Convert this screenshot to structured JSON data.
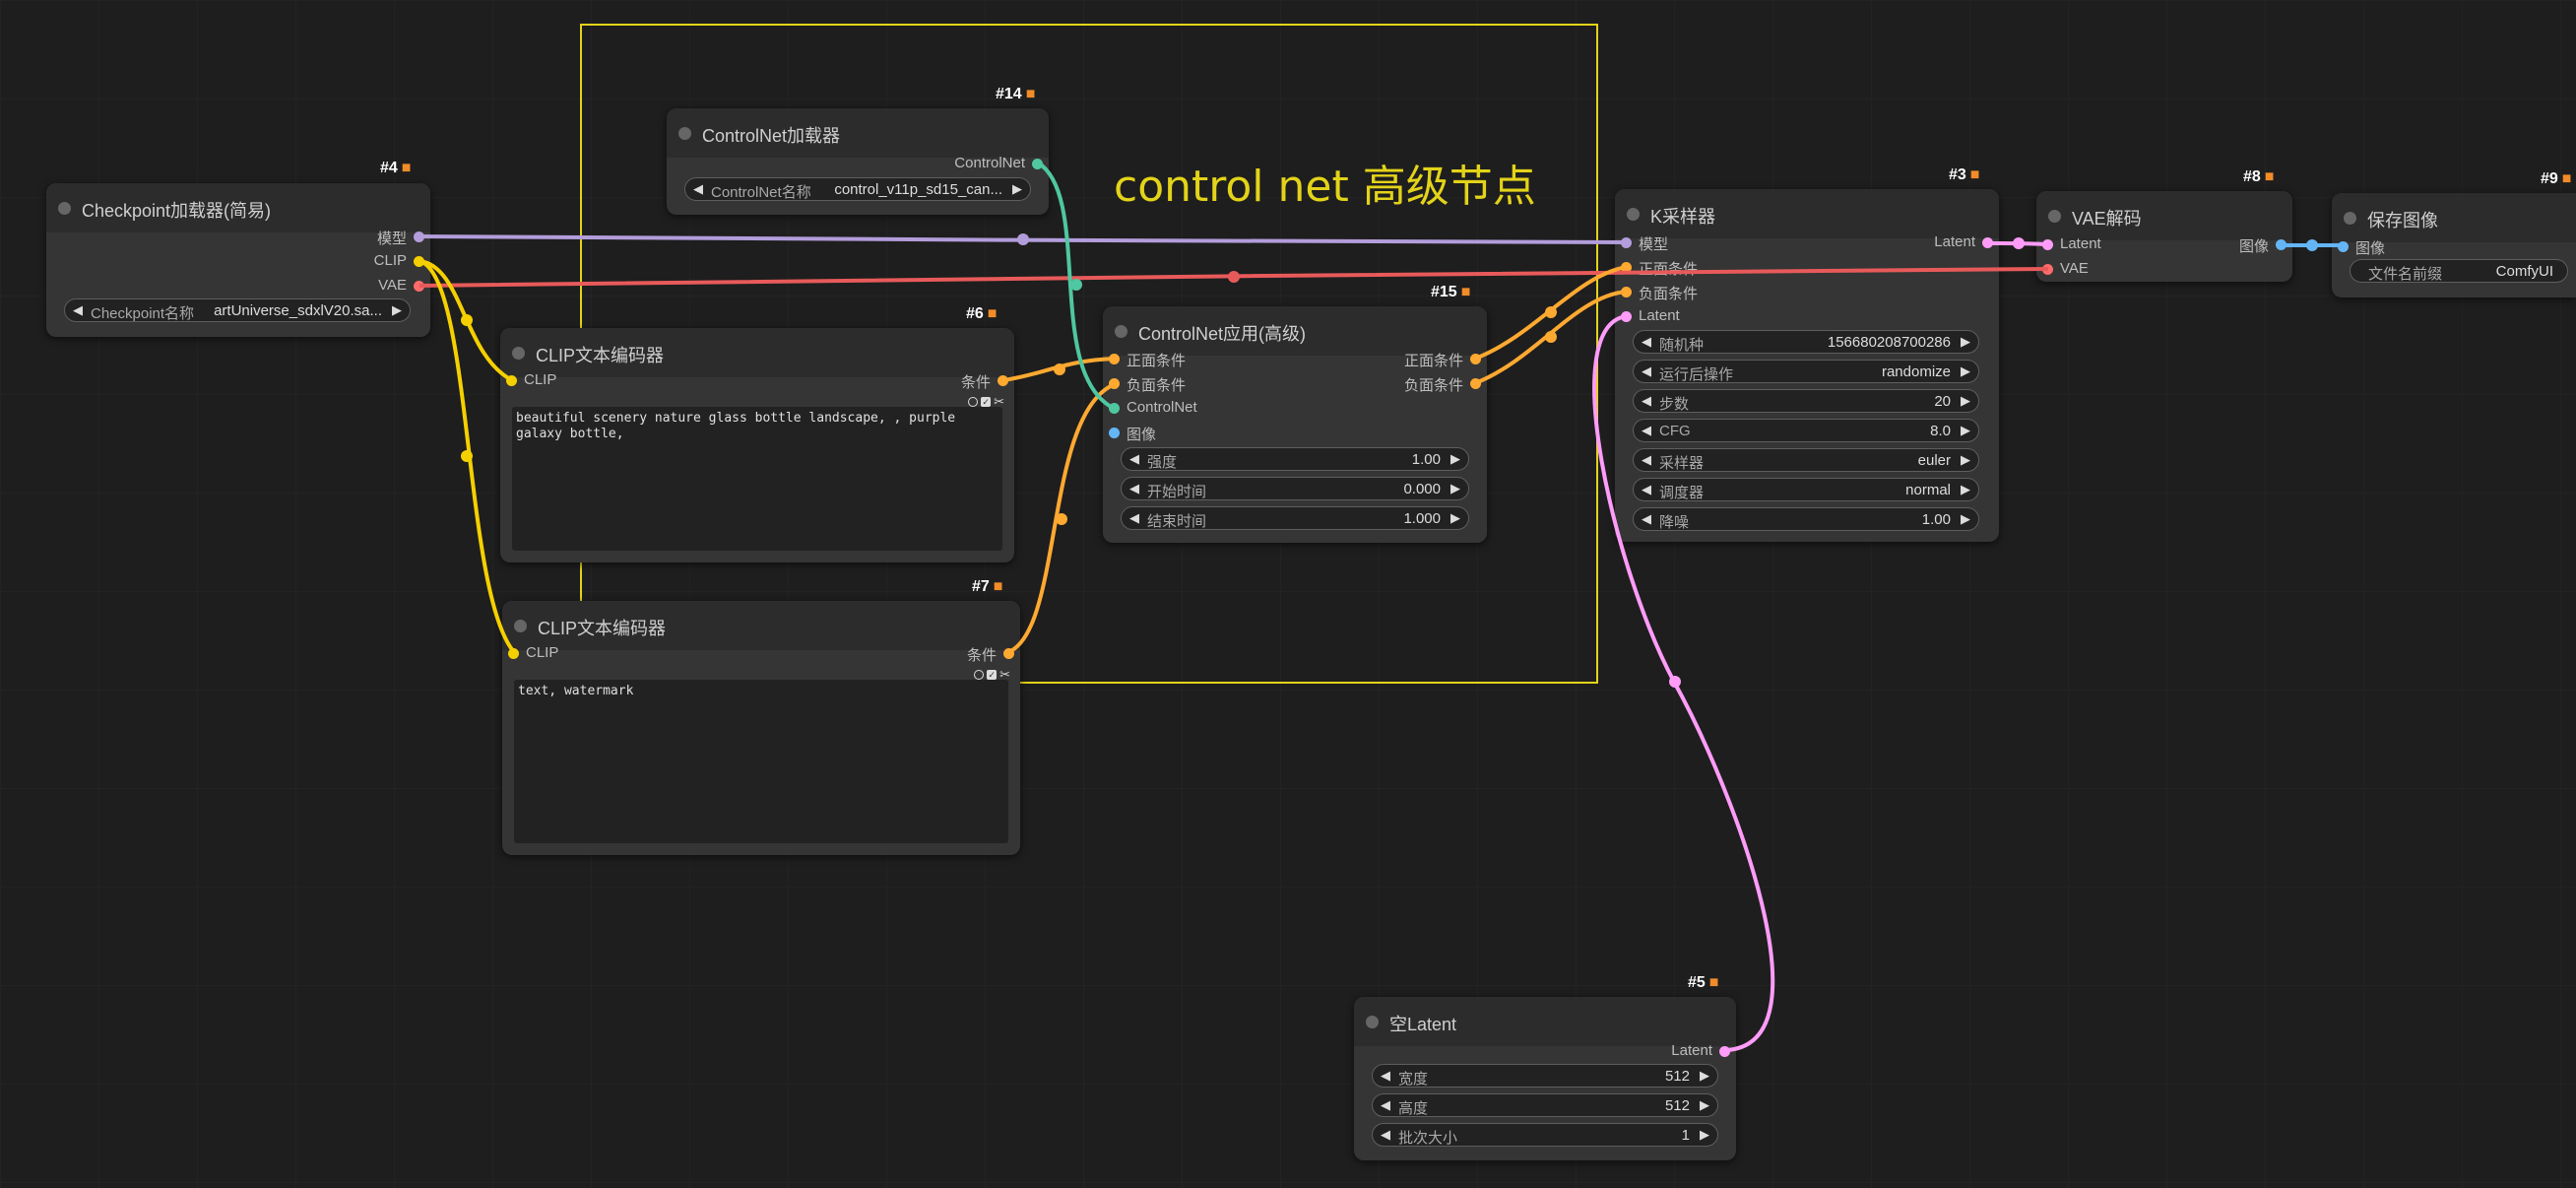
{
  "group": {
    "title": "control net 高级节点",
    "color": "#e3d319"
  },
  "nodes": {
    "checkpoint": {
      "id": "#4",
      "title": "Checkpoint加载器(简易)",
      "outputs": [
        "模型",
        "CLIP",
        "VAE"
      ],
      "widget": {
        "label": "Checkpoint名称",
        "value": "artUniverse_sdxlV20.sa..."
      }
    },
    "controlnet_loader": {
      "id": "#14",
      "title": "ControlNet加载器",
      "outputs": [
        "ControlNet"
      ],
      "widget": {
        "label": "ControlNet名称",
        "value": "control_v11p_sd15_can..."
      }
    },
    "clip_pos": {
      "id": "#6",
      "title": "CLIP文本编码器",
      "input": "CLIP",
      "output": "条件",
      "text": "beautiful scenery nature glass bottle landscape, , purple galaxy bottle,"
    },
    "clip_neg": {
      "id": "#7",
      "title": "CLIP文本编码器",
      "input": "CLIP",
      "output": "条件",
      "text": "text, watermark"
    },
    "controlnet_apply": {
      "id": "#15",
      "title": "ControlNet应用(高级)",
      "inputs": [
        "正面条件",
        "负面条件",
        "ControlNet",
        "图像"
      ],
      "outputs": [
        "正面条件",
        "负面条件"
      ],
      "widgets": [
        {
          "label": "强度",
          "value": "1.00"
        },
        {
          "label": "开始时间",
          "value": "0.000"
        },
        {
          "label": "结束时间",
          "value": "1.000"
        }
      ]
    },
    "ksampler": {
      "id": "#3",
      "title": "K采样器",
      "inputs": [
        "模型",
        "正面条件",
        "负面条件",
        "Latent"
      ],
      "output": "Latent",
      "widgets": [
        {
          "label": "随机种",
          "value": "156680208700286"
        },
        {
          "label": "运行后操作",
          "value": "randomize"
        },
        {
          "label": "步数",
          "value": "20"
        },
        {
          "label": "CFG",
          "value": "8.0"
        },
        {
          "label": "采样器",
          "value": "euler"
        },
        {
          "label": "调度器",
          "value": "normal"
        },
        {
          "label": "降噪",
          "value": "1.00"
        }
      ]
    },
    "vae_decode": {
      "id": "#8",
      "title": "VAE解码",
      "inputs": [
        "Latent",
        "VAE"
      ],
      "output": "图像"
    },
    "save_image": {
      "id": "#9",
      "title": "保存图像",
      "input": "图像",
      "widget": {
        "label": "文件名前缀",
        "value": "ComfyUI"
      }
    },
    "empty_latent": {
      "id": "#5",
      "title": "空Latent",
      "output": "Latent",
      "widgets": [
        {
          "label": "宽度",
          "value": "512"
        },
        {
          "label": "高度",
          "value": "512"
        },
        {
          "label": "批次大小",
          "value": "1"
        }
      ]
    }
  },
  "colors": {
    "model": "#b39ddb",
    "clip": "#f5d000",
    "vae": "#ff6b6b",
    "conditioning": "#ffa931",
    "controlnet": "#4fc7a0",
    "image": "#64b5f6",
    "latent": "#ff9cf9",
    "badge_icon": "#f28c28"
  },
  "icons": {
    "badge": "fox-icon",
    "arrow_left": "triangle-left-icon",
    "arrow_right": "triangle-right-icon"
  }
}
